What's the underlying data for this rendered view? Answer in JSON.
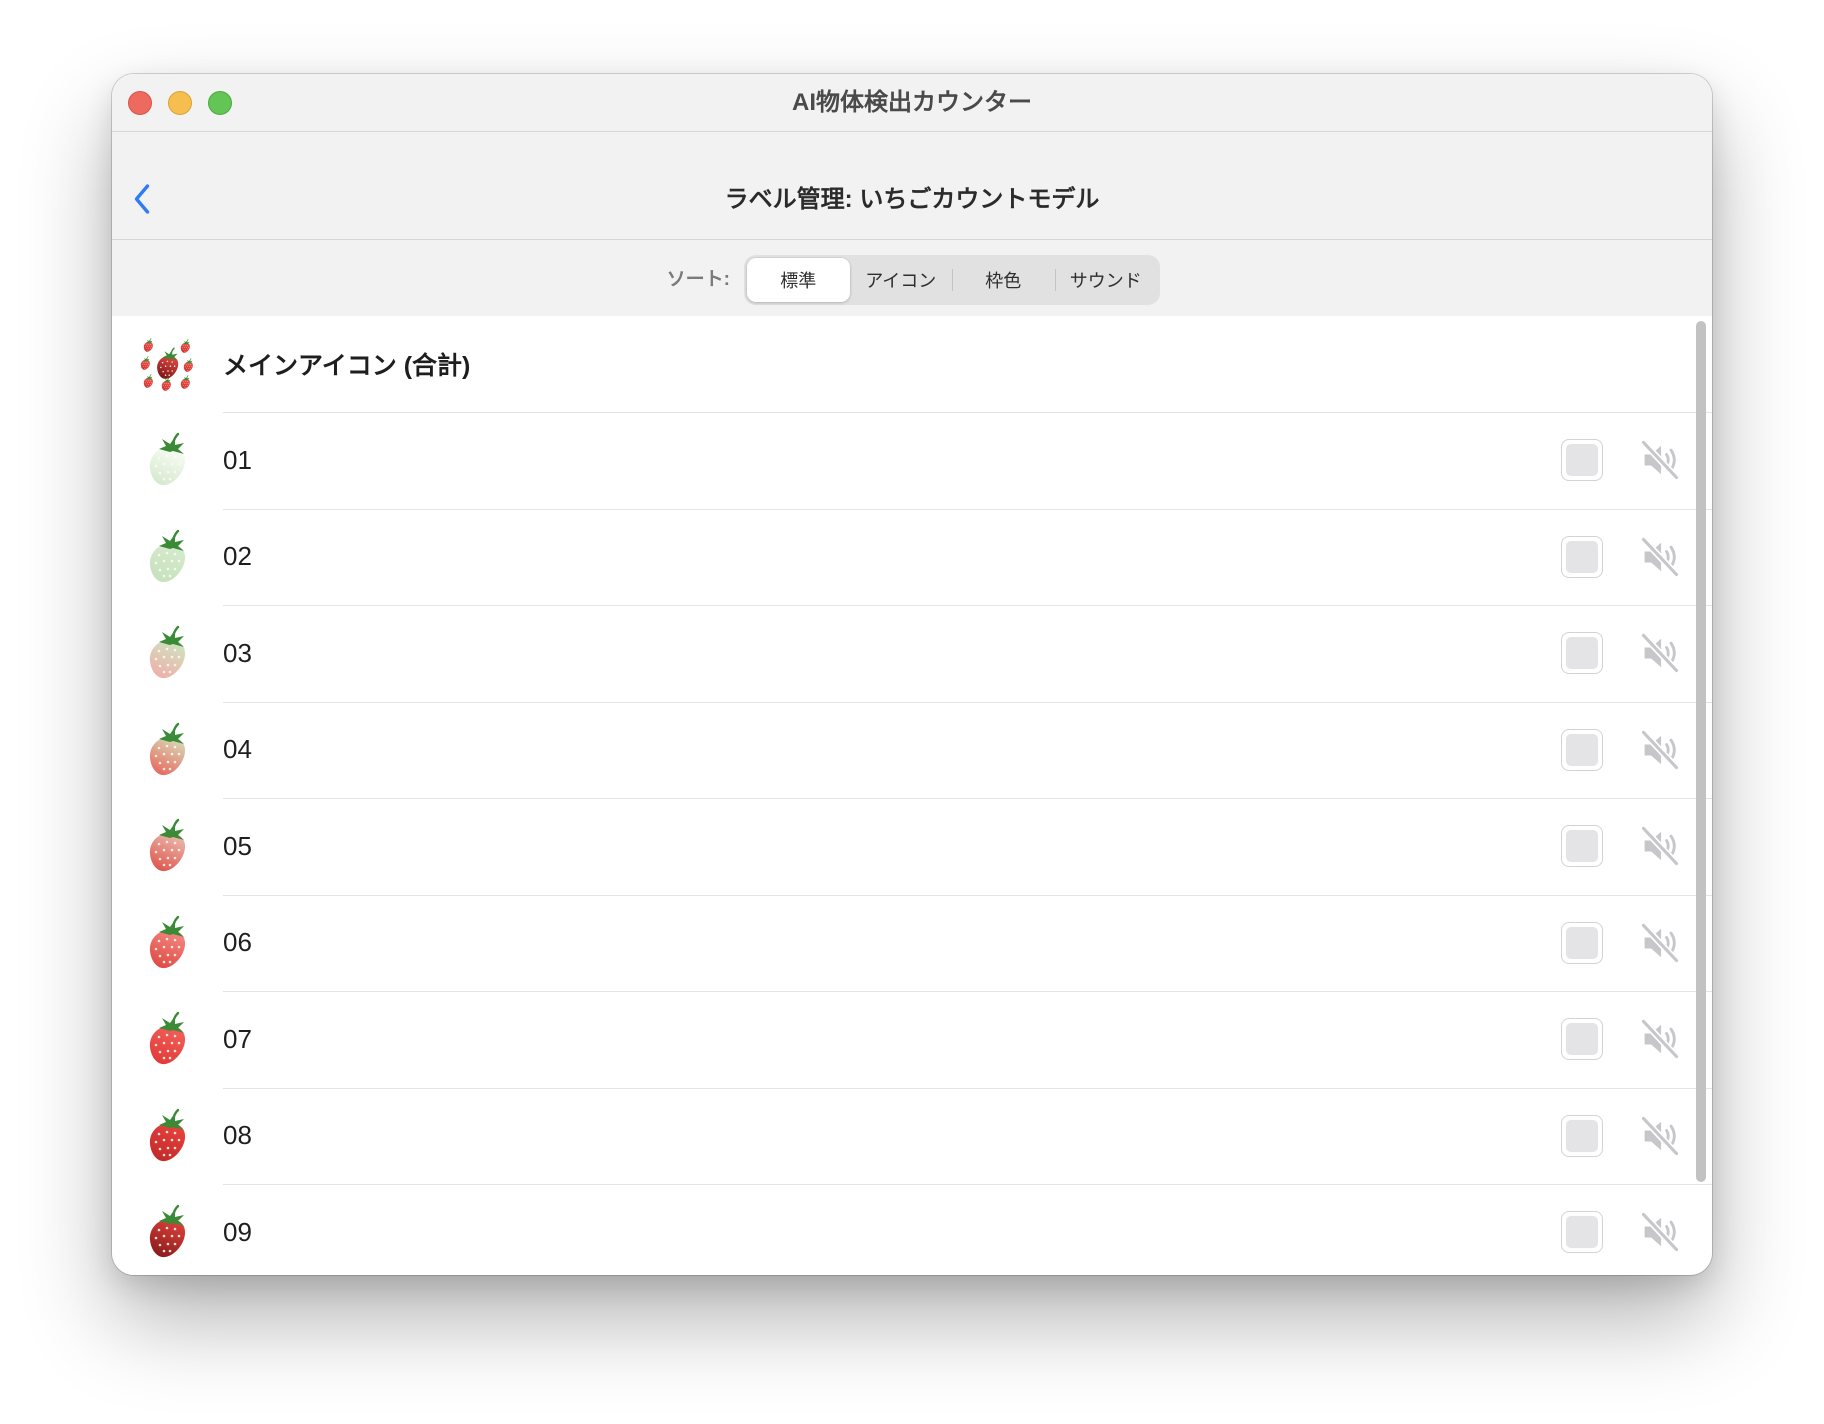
{
  "window": {
    "title": "AI物体検出カウンター"
  },
  "navbar": {
    "back_icon": "chevron-left-icon",
    "title": "ラベル管理: いちごカウントモデル"
  },
  "sort": {
    "label": "ソート:",
    "options": [
      "標準",
      "アイコン",
      "枠色",
      "サウンド"
    ],
    "selected_index": 0
  },
  "colors": {
    "accent": "#2f7cf6",
    "muted_icon": "#c6c6cb",
    "leaf": "#3b8a36"
  },
  "main_row": {
    "label": "メインアイコン (合計)",
    "icon": "strawberry-cluster-icon",
    "icon_colors": [
      "#e34a43",
      "#7d1717"
    ],
    "small_icon_colors": [
      "#f25a52",
      "#cf302e"
    ]
  },
  "rows": [
    {
      "name": "01",
      "icon": "strawberry-icon",
      "icon_colors": [
        "#fafdf8",
        "#d5e9ce"
      ],
      "frame_color": "#e4e4e6",
      "sound_icon": "speaker-muted-icon",
      "sound_muted": true
    },
    {
      "name": "02",
      "icon": "strawberry-icon",
      "icon_colors": [
        "#d6ebcf",
        "#c6e1bd"
      ],
      "frame_color": "#e4e4e6",
      "sound_icon": "speaker-muted-icon",
      "sound_muted": true
    },
    {
      "name": "03",
      "icon": "strawberry-icon",
      "icon_colors": [
        "#cde5c2",
        "#efb0a9"
      ],
      "frame_color": "#e4e4e6",
      "sound_icon": "speaker-muted-icon",
      "sound_muted": true
    },
    {
      "name": "04",
      "icon": "strawberry-icon",
      "icon_colors": [
        "#d5dcb9",
        "#e86a60"
      ],
      "frame_color": "#e4e4e6",
      "sound_icon": "speaker-muted-icon",
      "sound_muted": true
    },
    {
      "name": "05",
      "icon": "strawberry-icon",
      "icon_colors": [
        "#ebbcb0",
        "#df564e"
      ],
      "frame_color": "#e4e4e6",
      "sound_icon": "speaker-muted-icon",
      "sound_muted": true
    },
    {
      "name": "06",
      "icon": "strawberry-icon",
      "icon_colors": [
        "#f28a82",
        "#e04a45"
      ],
      "frame_color": "#e4e4e6",
      "sound_icon": "speaker-muted-icon",
      "sound_muted": true
    },
    {
      "name": "07",
      "icon": "strawberry-icon",
      "icon_colors": [
        "#f4605a",
        "#e13b38"
      ],
      "frame_color": "#e4e4e6",
      "sound_icon": "speaker-muted-icon",
      "sound_muted": true
    },
    {
      "name": "08",
      "icon": "strawberry-icon",
      "icon_colors": [
        "#ea433e",
        "#c22a2a"
      ],
      "frame_color": "#e4e4e6",
      "sound_icon": "speaker-muted-icon",
      "sound_muted": true
    },
    {
      "name": "09",
      "icon": "strawberry-icon",
      "icon_colors": [
        "#df413b",
        "#8a1c1c"
      ],
      "frame_color": "#e4e4e6",
      "sound_icon": "speaker-muted-icon",
      "sound_muted": true
    }
  ]
}
